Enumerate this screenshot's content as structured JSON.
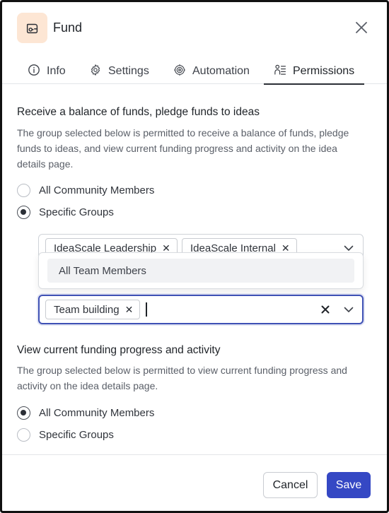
{
  "dialog": {
    "title": "Fund",
    "icon": "fund-wallet-icon",
    "accent": "#3548c4",
    "logo_bg": "#fde6d4"
  },
  "tabs": [
    {
      "label": "Info",
      "icon": "info-icon",
      "active": false
    },
    {
      "label": "Settings",
      "icon": "gear-icon",
      "active": false
    },
    {
      "label": "Automation",
      "icon": "automation-icon",
      "active": false
    },
    {
      "label": "Permissions",
      "icon": "permissions-icon",
      "active": true
    }
  ],
  "section1": {
    "title": "Receive a balance of funds, pledge funds to ideas",
    "description": "The group selected below is permitted to receive a balance of funds, pledge funds to ideas, and view current funding progress and activity on the idea details page.",
    "options": [
      {
        "label": "All Community Members",
        "checked": false
      },
      {
        "label": "Specific Groups",
        "checked": true
      }
    ],
    "selected_groups": [
      "IdeaScale Leadership",
      "IdeaScale Internal"
    ],
    "dropdown_options": [
      "All Team Members"
    ],
    "second_select_chips": [
      "Team building"
    ]
  },
  "section2": {
    "title": "View current funding progress and activity",
    "description": "The group selected below is permitted to view current funding progress and activity on the idea details page.",
    "options": [
      {
        "label": "All Community Members",
        "checked": true
      },
      {
        "label": "Specific Groups",
        "checked": false
      }
    ]
  },
  "footer": {
    "cancel_label": "Cancel",
    "save_label": "Save"
  }
}
